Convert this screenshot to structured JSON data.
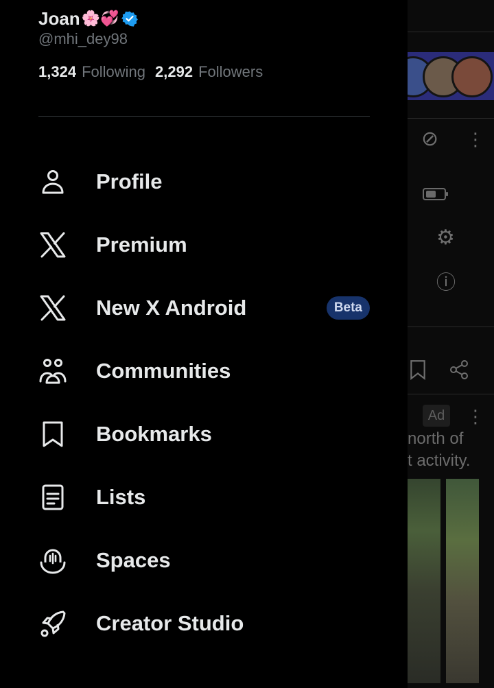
{
  "profile": {
    "name": "Joan",
    "emoji": "🌸💞",
    "handle": "@mhi_dey98",
    "following_count": "1,324",
    "following_label": "Following",
    "followers_count": "2,292",
    "followers_label": "Followers"
  },
  "menu": [
    {
      "label": "Profile",
      "icon": "person-icon"
    },
    {
      "label": "Premium",
      "icon": "x-logo-icon"
    },
    {
      "label": "New X Android",
      "icon": "x-logo-icon",
      "badge": "Beta"
    },
    {
      "label": "Communities",
      "icon": "communities-icon"
    },
    {
      "label": "Bookmarks",
      "icon": "bookmark-icon"
    },
    {
      "label": "Lists",
      "icon": "list-icon"
    },
    {
      "label": "Spaces",
      "icon": "spaces-icon"
    },
    {
      "label": "Creator Studio",
      "icon": "rocket-icon"
    }
  ],
  "background": {
    "ad_label": "Ad",
    "ad_text_line1": "north of",
    "ad_text_line2": "t activity."
  },
  "colors": {
    "background": "#000000",
    "text_primary": "#e7e9ea",
    "text_secondary": "#71767b",
    "verified": "#1d9bf0",
    "beta_badge_bg": "#17336b"
  }
}
